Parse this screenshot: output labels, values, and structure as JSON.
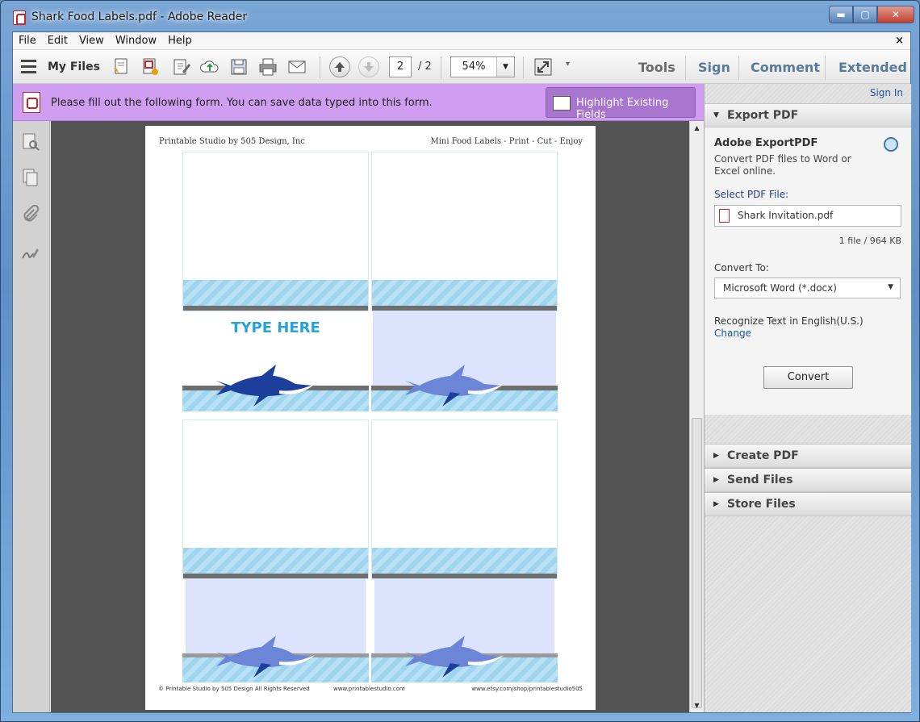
{
  "window": {
    "title": "Shark Food Labels.pdf - Adobe Reader",
    "min": "▬",
    "max": "▢",
    "close": "✕"
  },
  "menu": {
    "items": [
      "File",
      "Edit",
      "View",
      "Window",
      "Help"
    ],
    "close": "×"
  },
  "toolbar": {
    "my_files": "My Files",
    "page_current": "2",
    "page_total": "/ 2",
    "zoom": "54%",
    "tools": "Tools",
    "sign": "Sign",
    "comment": "Comment",
    "extended": "Extended"
  },
  "formbar": {
    "message": "Please fill out the following form. You can save data typed into this form.",
    "highlight": "Highlight Existing Fields"
  },
  "document": {
    "header_left": "Printable Studio by 505 Design, Inc",
    "header_right": "Mini Food Labels - Print - Cut - Enjoy",
    "type_here": "TYPE HERE",
    "footer_left": "© Printable Studio by 505 Design All Rights Reserved",
    "footer_mid": "www.printablestudio.com",
    "footer_right": "www.etsy.com/shop/printablestudio505"
  },
  "rightpane": {
    "sign_in": "Sign In",
    "export_pdf": "Export PDF",
    "export": {
      "title": "Adobe ExportPDF",
      "desc": "Convert PDF files to Word or Excel online.",
      "select_label": "Select PDF File:",
      "file_name": "Shark Invitation.pdf",
      "file_info": "1 file / 964 KB",
      "convert_to": "Convert To:",
      "format": "Microsoft Word (*.docx)",
      "recognize": "Recognize Text in English(U.S.)",
      "change": "Change",
      "convert_btn": "Convert"
    },
    "create_pdf": "Create PDF",
    "send_files": "Send Files",
    "store_files": "Store Files"
  },
  "colors": {
    "formbar": "#cf9ef0",
    "shark": "#1d3f9c",
    "shark_faded": "#6b86d6",
    "type_here": "#27a3dc"
  }
}
